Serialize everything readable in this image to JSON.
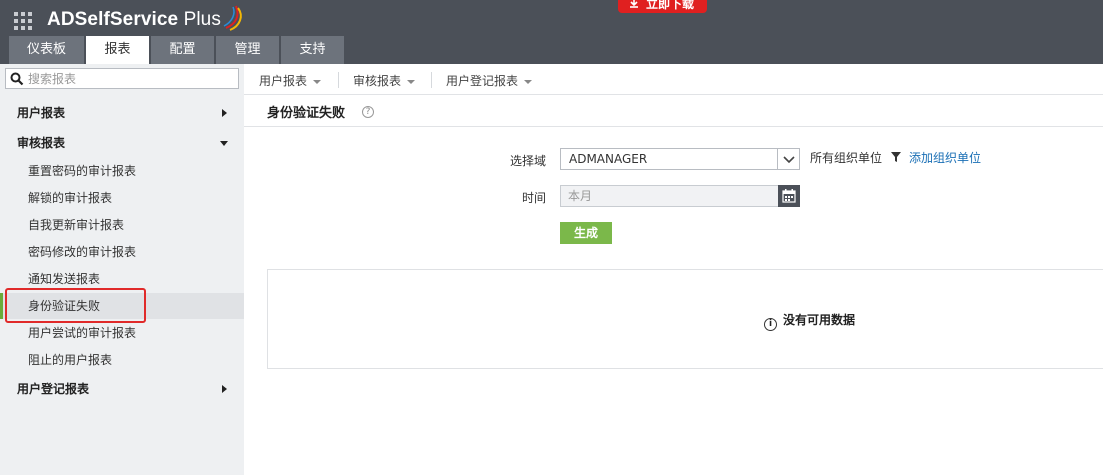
{
  "header": {
    "app_name": "ADSelfService",
    "app_name_suffix": " Plus",
    "download_label": "立即下载",
    "brand_colors": {
      "red": "#e02020",
      "header_bg": "#4b5058",
      "green": "#7bb84a",
      "link": "#1a6fb5"
    },
    "tabs": [
      {
        "label": "仪表板",
        "active": false
      },
      {
        "label": "报表",
        "active": true
      },
      {
        "label": "配置",
        "active": false
      },
      {
        "label": "管理",
        "active": false
      },
      {
        "label": "支持",
        "active": false
      }
    ]
  },
  "sidebar": {
    "search_placeholder": "搜索报表",
    "sections": [
      {
        "label": "用户报表",
        "expanded": false
      },
      {
        "label": "审核报表",
        "expanded": true
      },
      {
        "label": "用户登记报表",
        "expanded": false
      }
    ],
    "audit_items": [
      "重置密码的审计报表",
      "解锁的审计报表",
      "自我更新审计报表",
      "密码修改的审计报表",
      "通知发送报表",
      "身份验证失败",
      "用户尝试的审计报表",
      "阻止的用户报表"
    ],
    "selected_item": "身份验证失败"
  },
  "submenu": [
    {
      "label": "用户报表"
    },
    {
      "label": "审核报表"
    },
    {
      "label": "用户登记报表"
    }
  ],
  "main": {
    "title": "身份验证失败",
    "help_icon": "?",
    "domain_label": "选择域",
    "domain_value": "ADMANAGER",
    "ou_text": "所有组织单位",
    "ou_link": "添加组织单位",
    "time_label": "时间",
    "time_placeholder": "本月",
    "generate_label": "生成",
    "no_data_text": "没有可用数据",
    "info_icon": "i"
  }
}
